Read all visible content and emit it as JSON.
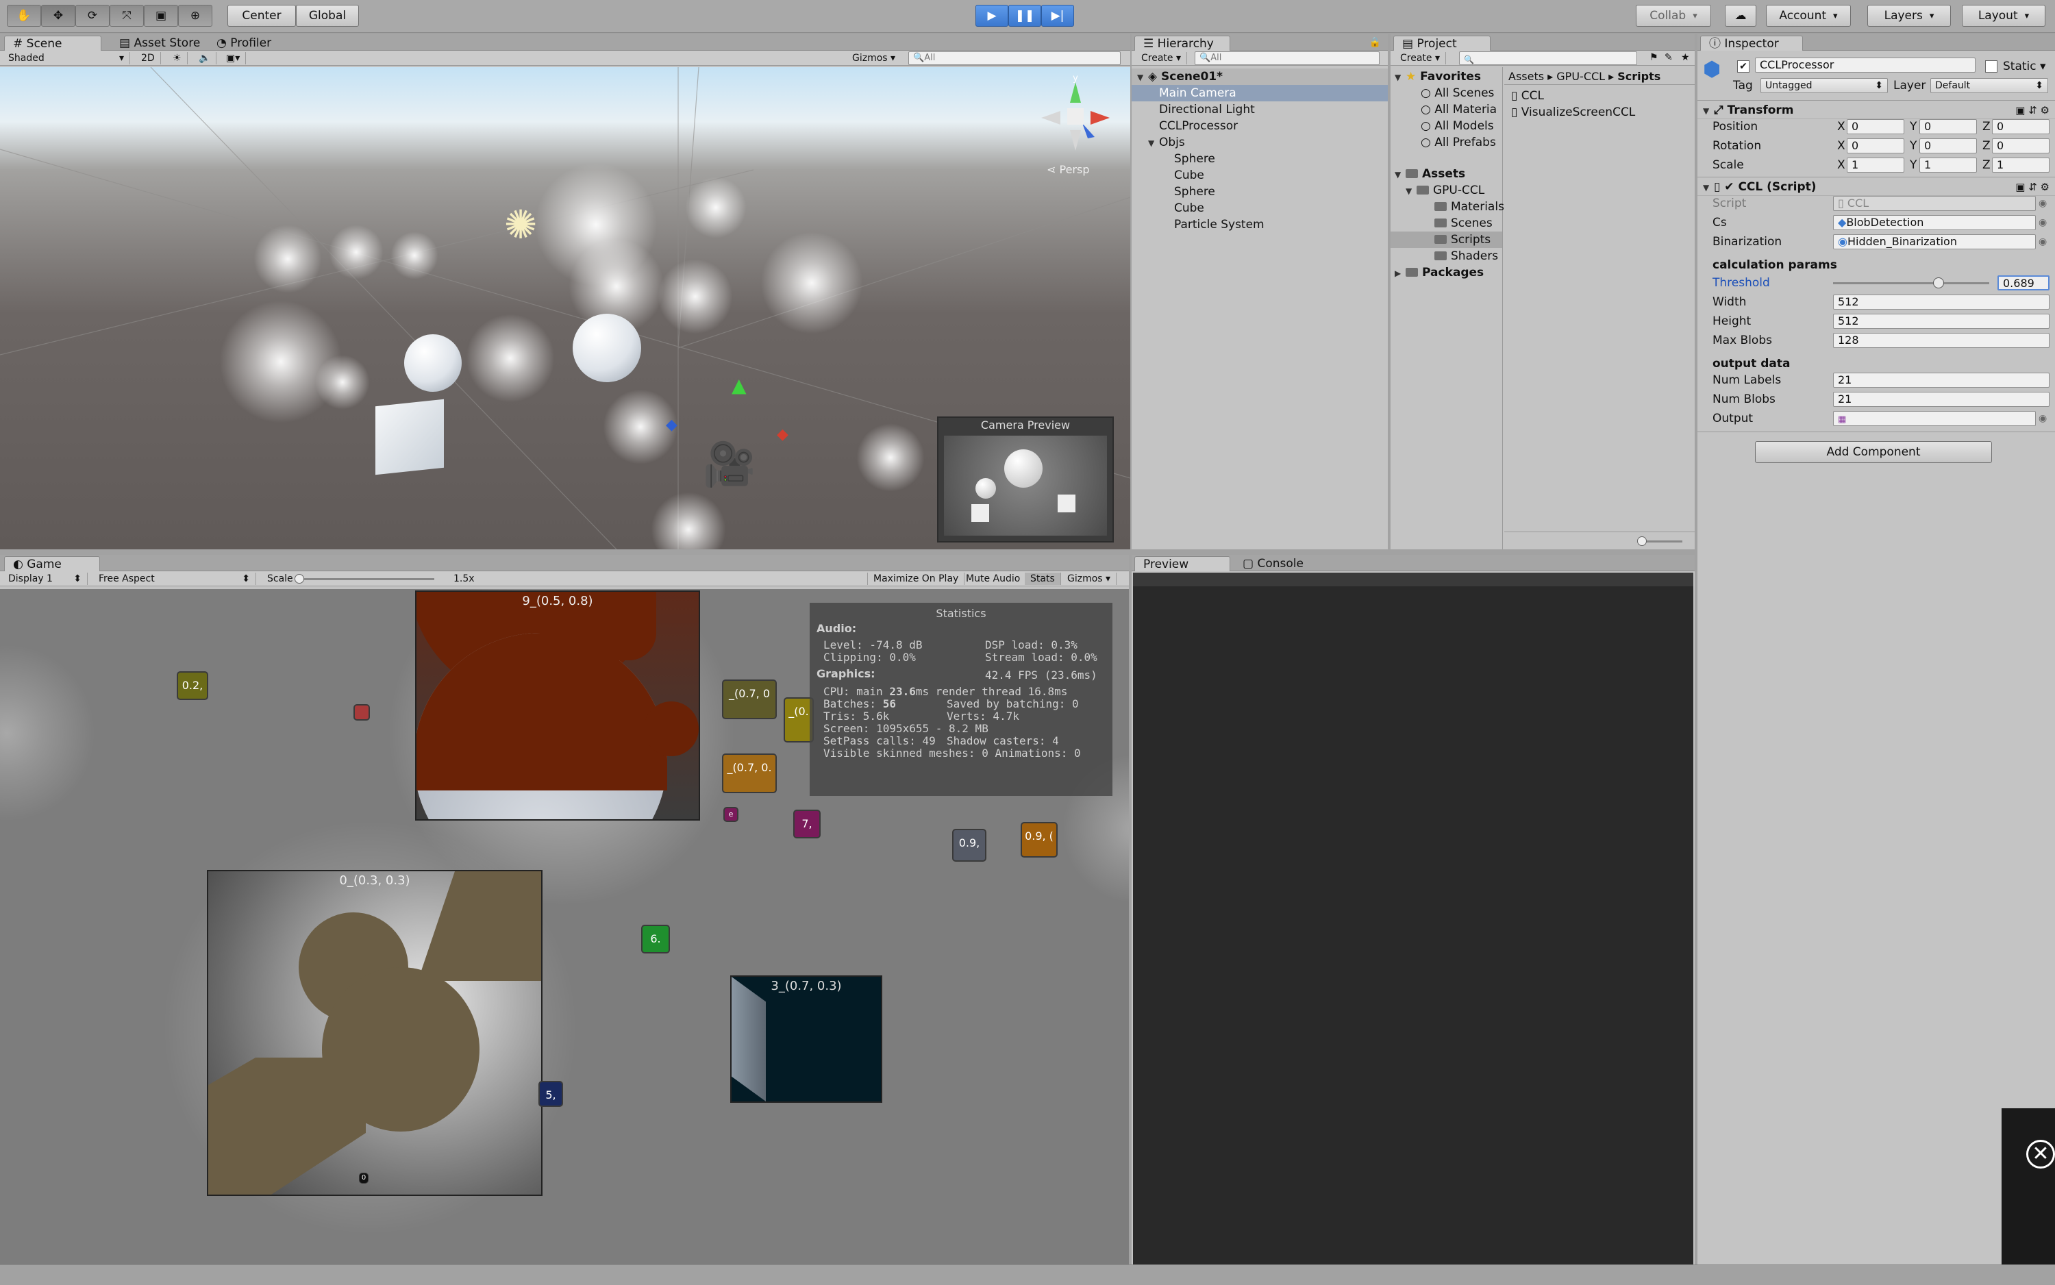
{
  "toolbar": {
    "pivot": "Center",
    "space": "Global",
    "collab": "Collab",
    "account": "Account",
    "layers": "Layers",
    "layout": "Layout"
  },
  "scene": {
    "tab": "Scene",
    "tab2": "Asset Store",
    "tab3": "Profiler",
    "mode": "Shaded",
    "btn2d": "2D",
    "gizmos": "Gizmos",
    "search": "All",
    "persp": "Persp",
    "camera_preview": "Camera Preview"
  },
  "game": {
    "tab": "Game",
    "display": "Display 1",
    "aspect": "Free Aspect",
    "scale_label": "Scale",
    "scale_value": "1.5x",
    "maximize": "Maximize On Play",
    "mute": "Mute Audio",
    "stats": "Stats",
    "gizmos": "Gizmos",
    "boxes": {
      "b9": "9_(0.5, 0.8)",
      "b0": "0_(0.3, 0.3)",
      "b3": "3_(0.7, 0.3)"
    },
    "chips": {
      "c1": "0.2,",
      "c2": "_(0.7, 0",
      "c3": "_(0.",
      "c4": "_(0.7, 0.",
      "c5": "e",
      "c6": "7,",
      "c7": "0.9,",
      "c8": "0.9, (",
      "c9": "6.",
      "c10": "5,",
      "c11": "0"
    }
  },
  "stats": {
    "title": "Statistics",
    "audio": "Audio:",
    "level": "Level: -74.8 dB",
    "clipping": "Clipping: 0.0%",
    "dsp": "DSP load: 0.3%",
    "stream": "Stream load: 0.0%",
    "graphics": "Graphics:",
    "fps": "42.4 FPS (23.6ms)",
    "cpu_a": "CPU: main ",
    "cpu_b": "23.6",
    "cpu_c": "ms  render thread 16.8ms",
    "batches_a": "Batches: ",
    "batches_b": "56",
    "saved": "Saved by batching: 0",
    "tris": "Tris: 5.6k",
    "verts": "Verts: 4.7k",
    "screen": "Screen: 1095x655 - 8.2 MB",
    "setpass": "SetPass calls: 49",
    "shadow": "Shadow casters: 4",
    "skinned": "Visible skinned meshes: 0  Animations: 0"
  },
  "hierarchy": {
    "tab": "Hierarchy",
    "create": "Create",
    "search": "All",
    "scene": "Scene01*",
    "items": [
      "Main Camera",
      "Directional Light",
      "CCLProcessor",
      "Objs",
      "Sphere",
      "Cube",
      "Sphere",
      "Cube",
      "Particle System"
    ]
  },
  "project": {
    "tab": "Project",
    "create": "Create",
    "favorites": "Favorites",
    "fav_items": [
      "All Scenes",
      "All Materia",
      "All Models",
      "All Prefabs"
    ],
    "assets": "Assets",
    "gpuccl": "GPU-CCL",
    "sub": [
      "Materials",
      "Scenes",
      "Scripts",
      "Shaders"
    ],
    "packages": "Packages",
    "breadcrumb": [
      "Assets",
      "GPU-CCL",
      "Scripts"
    ],
    "files": [
      "CCL",
      "VisualizeScreenCCL"
    ]
  },
  "preview": {
    "tab": "Preview",
    "console": "Console"
  },
  "inspector": {
    "tab": "Inspector",
    "name": "CCLProcessor",
    "static": "Static",
    "tag_label": "Tag",
    "tag": "Untagged",
    "layer_label": "Layer",
    "layer": "Default",
    "transform": "Transform",
    "position": "Position",
    "rotation": "Rotation",
    "scale": "Scale",
    "x": "X",
    "y": "Y",
    "z": "Z",
    "pos": [
      "0",
      "0",
      "0"
    ],
    "rot": [
      "0",
      "0",
      "0"
    ],
    "scl": [
      "1",
      "1",
      "1"
    ],
    "ccl": "CCL (Script)",
    "script_label": "Script",
    "script": "CCL",
    "cs_label": "Cs",
    "cs": "BlobDetection",
    "bin_label": "Binarization",
    "bin": "Hidden_Binarization",
    "calc": "calculation params",
    "threshold_label": "Threshold",
    "threshold": "0.689",
    "threshold_fraction": 0.689,
    "width_label": "Width",
    "width": "512",
    "height_label": "Height",
    "height": "512",
    "maxblobs_label": "Max Blobs",
    "maxblobs": "128",
    "output": "output data",
    "numlabels_label": "Num Labels",
    "numlabels": "21",
    "numblobs_label": "Num Blobs",
    "numblobs": "21",
    "output_label": "Output",
    "add_component": "Add Component"
  }
}
